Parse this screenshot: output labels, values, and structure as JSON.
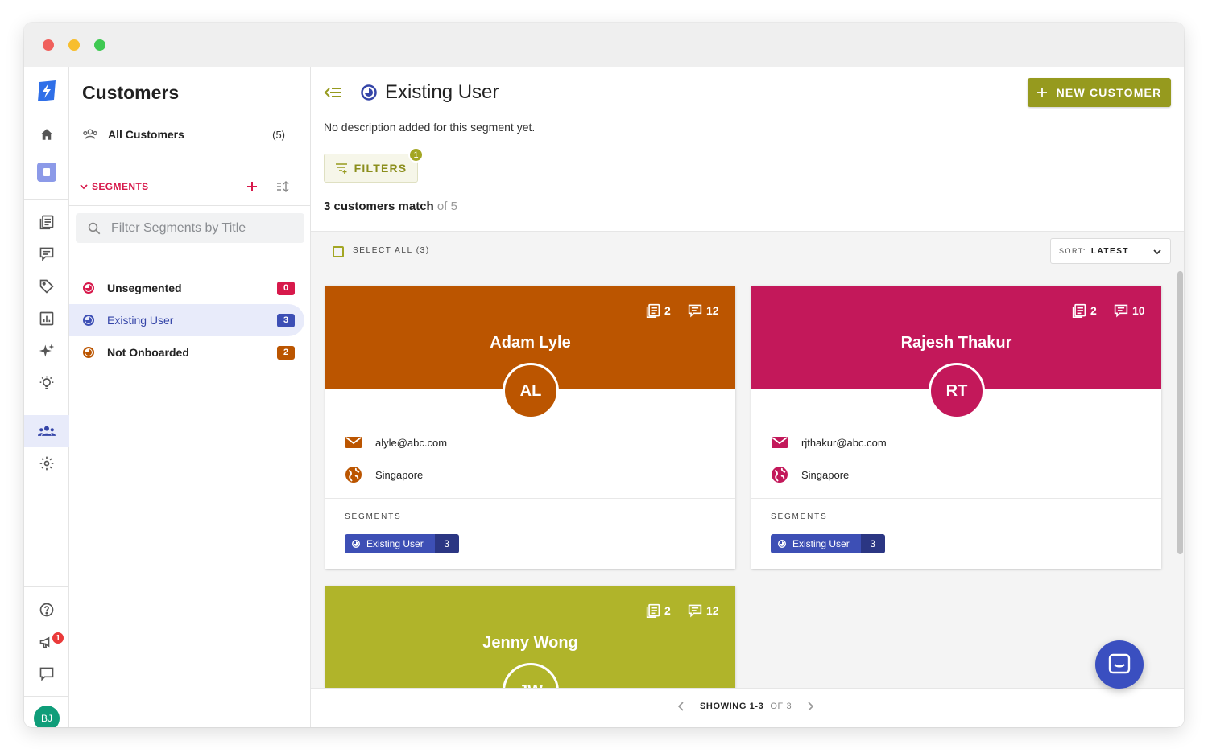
{
  "colors": {
    "accent": "#969a1e",
    "segment_accent": "#d7194b",
    "active_blue": "#3545a8",
    "card_orange": "#bb5500",
    "card_pink": "#c3185a",
    "card_olive": "#b0b42a"
  },
  "rail": {
    "icons": [
      "logo-icon",
      "home-icon",
      "bookmark-icon",
      "articles-icon",
      "conversations-icon",
      "tag-icon",
      "reports-icon",
      "sparkle-icon",
      "lightbulb-icon",
      "customers-icon",
      "settings-icon",
      "help-icon",
      "megaphone-icon",
      "chat-icon"
    ],
    "notification_count": "1",
    "user_initials": "BJ"
  },
  "sidebar": {
    "title": "Customers",
    "all_customers": {
      "label": "All Customers",
      "count": "(5)"
    },
    "segments_heading": "SEGMENTS",
    "search_placeholder": "Filter Segments by Title",
    "segments": [
      {
        "label": "Unsegmented",
        "count": "0",
        "color": "#d7194b"
      },
      {
        "label": "Existing User",
        "count": "3",
        "color": "#3d4fb5"
      },
      {
        "label": "Not Onboarded",
        "count": "2",
        "color": "#bb5500"
      }
    ]
  },
  "header": {
    "title": "Existing User",
    "description": "No description added for this segment yet.",
    "new_button": "NEW CUSTOMER",
    "filters_label": "FILTERS",
    "filters_count": "1",
    "match_bold": "3 customers match",
    "match_rest": "of 5"
  },
  "list": {
    "select_all": "SELECT ALL (3)",
    "sort_key": "SORT:",
    "sort_value": "LATEST"
  },
  "customers": [
    {
      "name": "Adam Lyle",
      "initials": "AL",
      "articles": "2",
      "conversations": "12",
      "email": "alyle@abc.com",
      "location": "Singapore",
      "color": "#bb5500",
      "segments_label": "SEGMENTS",
      "segment_chip": "Existing User",
      "segment_count": "3"
    },
    {
      "name": "Rajesh Thakur",
      "initials": "RT",
      "articles": "2",
      "conversations": "10",
      "email": "rjthakur@abc.com",
      "location": "Singapore",
      "color": "#c3185a",
      "segments_label": "SEGMENTS",
      "segment_chip": "Existing User",
      "segment_count": "3"
    },
    {
      "name": "Jenny Wong",
      "initials": "JW",
      "articles": "2",
      "conversations": "12",
      "color": "#b0b42a"
    }
  ],
  "pager": {
    "showing": "SHOWING 1-3",
    "of": "OF 3"
  }
}
